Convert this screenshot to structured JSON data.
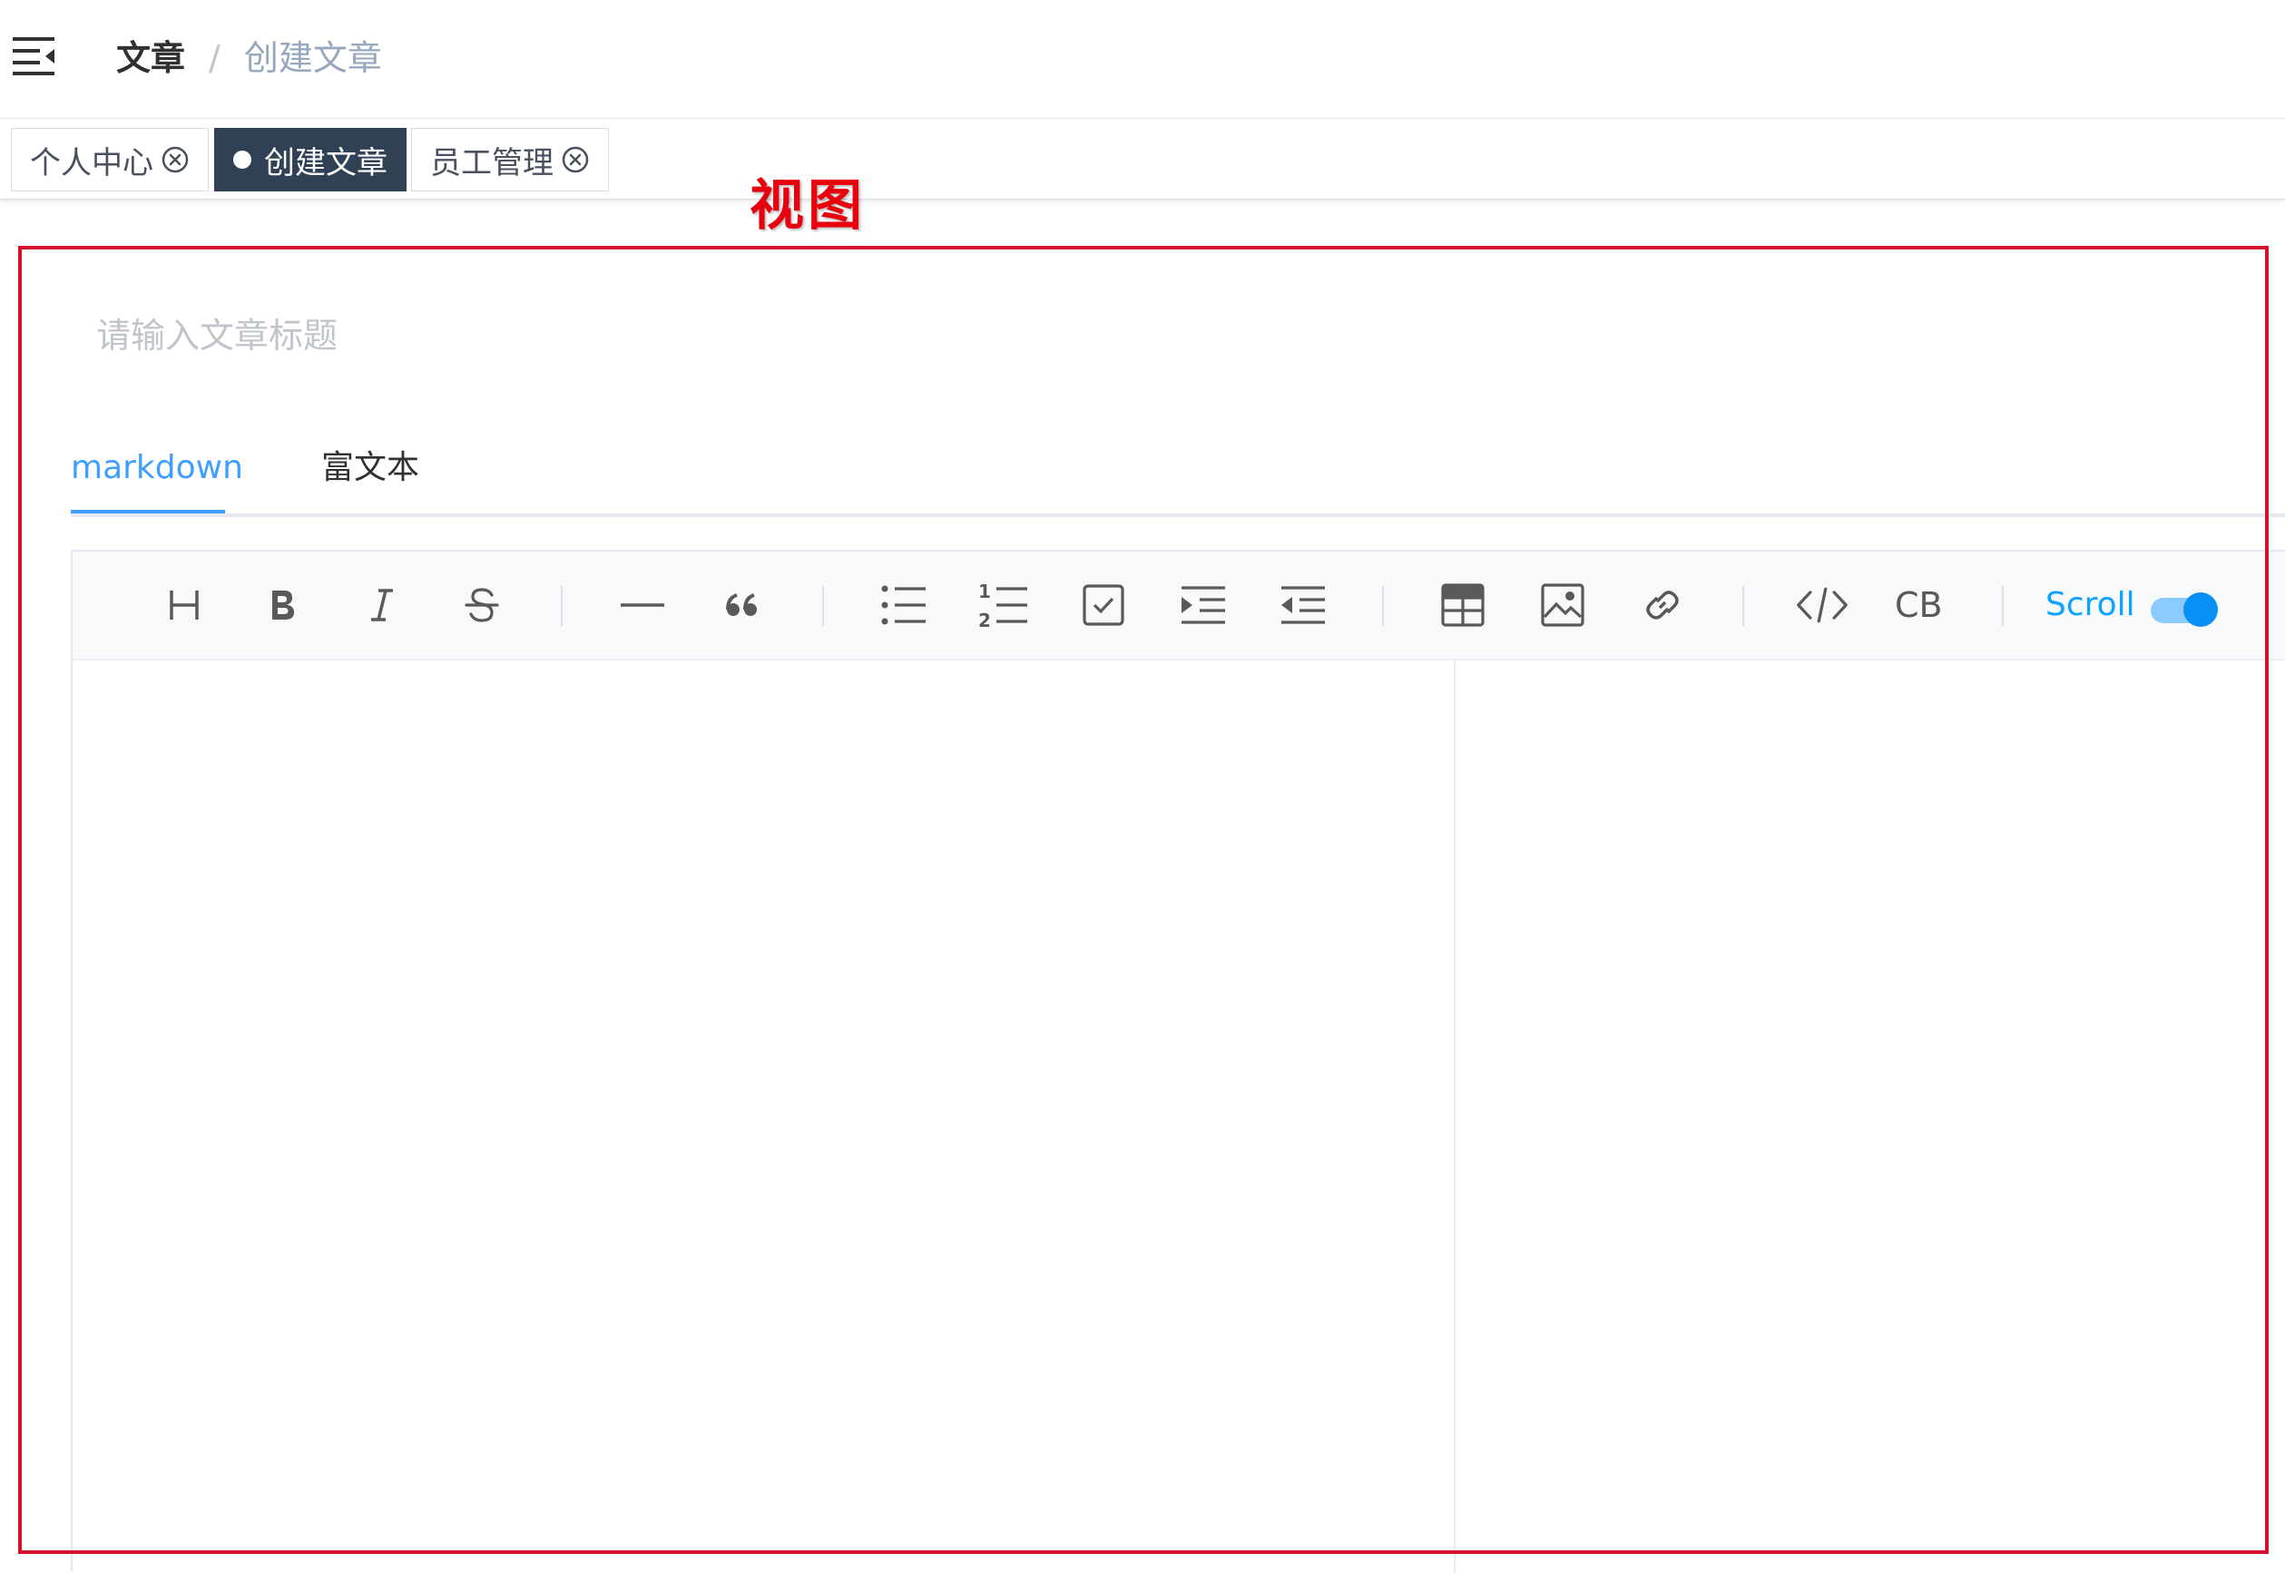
{
  "header": {
    "breadcrumb": {
      "parent": "文章",
      "separator": "/",
      "current": "创建文章"
    }
  },
  "tags": [
    {
      "label": "个人中心",
      "active": false,
      "closable": true
    },
    {
      "label": "创建文章",
      "active": true,
      "closable": false
    },
    {
      "label": "员工管理",
      "active": false,
      "closable": true
    }
  ],
  "annotation": {
    "label": "视图",
    "color": "#d5102b"
  },
  "article": {
    "title_placeholder": "请输入文章标题",
    "title_value": ""
  },
  "editor_tabs": [
    {
      "label": "markdown",
      "active": true
    },
    {
      "label": "富文本",
      "active": false
    }
  ],
  "toolbar": {
    "items": [
      "heading-icon",
      "bold-icon",
      "italic-icon",
      "strikethrough-icon",
      "horizontal-rule-icon",
      "quote-icon",
      "bullet-list-icon",
      "ordered-list-icon",
      "task-list-icon",
      "indent-icon",
      "outdent-icon",
      "table-icon",
      "image-icon",
      "link-icon",
      "code-icon",
      "code-block"
    ],
    "code_block_label": "CB",
    "scroll_label": "Scroll",
    "scroll_sync": true
  },
  "colors": {
    "accent": "#409eff",
    "active_tag_bg": "#304156",
    "scroll_accent": "#0a8ff5",
    "annotation_red": "#e8000d"
  }
}
